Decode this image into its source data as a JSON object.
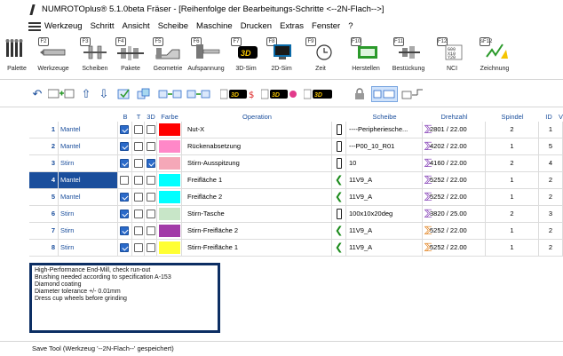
{
  "window": {
    "title": "NUMROTOplus®  5.1.0beta Fräser - [Reihenfolge der Bearbeitungs-Schritte <--2N-Flach-->]"
  },
  "menu": [
    "Werkzeug",
    "Schritt",
    "Ansicht",
    "Scheibe",
    "Maschine",
    "Drucken",
    "Extras",
    "Fenster",
    "?"
  ],
  "toolbar": [
    {
      "label": "Palette",
      "key": "",
      "icon": "palette-icon"
    },
    {
      "label": "Werkzeuge",
      "key": "F2",
      "icon": "tool-icon"
    },
    {
      "label": "Scheiben",
      "key": "F3",
      "icon": "wheel-icon"
    },
    {
      "label": "Pakete",
      "key": "F4",
      "icon": "package-icon"
    },
    {
      "label": "Geometrie",
      "key": "F5",
      "icon": "geometry-icon"
    },
    {
      "label": "Aufspannung",
      "key": "F6",
      "icon": "clamping-icon"
    },
    {
      "label": "3D-Sim",
      "key": "F7",
      "icon": "3d-sim-icon"
    },
    {
      "label": "2D-Sim",
      "key": "F8",
      "icon": "2d-sim-icon"
    },
    {
      "label": "Zeit",
      "key": "F9",
      "icon": "clock-icon"
    },
    {
      "label": "Herstellen",
      "key": "F10",
      "icon": "produce-icon"
    },
    {
      "label": "Bestückung",
      "key": "F11",
      "icon": "loading-icon"
    },
    {
      "label": "NCI",
      "key": "F12",
      "icon": "nci-icon"
    },
    {
      "label": "Zeichnung",
      "key": "sF12",
      "icon": "drawing-icon"
    }
  ],
  "grid": {
    "headers": {
      "b": "B",
      "t": "T",
      "d3": "3D",
      "farbe": "Farbe",
      "operation": "Operation",
      "scheibe": "Scheibe",
      "drehzahl": "Drehzahl",
      "spindel": "Spindel",
      "id": "ID",
      "more": "V"
    },
    "rows": [
      {
        "idx": "1",
        "name": "Mantel",
        "b": true,
        "t": false,
        "d3": false,
        "color": "#ff0000",
        "operation": "Nut-X",
        "tool": "bar",
        "scheibe": "----Peripheriesche...",
        "dz_icon": "violet",
        "drehzahl": "2801 / 22.00",
        "spindel": "2",
        "id": "1",
        "selected": false
      },
      {
        "idx": "2",
        "name": "Mantel",
        "b": true,
        "t": false,
        "d3": false,
        "color": "#ff88c8",
        "operation": "Rückenabsetzung",
        "tool": "bar",
        "scheibe": "---P00_10_R01",
        "dz_icon": "violet",
        "drehzahl": "4202 / 22.00",
        "spindel": "1",
        "id": "5",
        "selected": false
      },
      {
        "idx": "3",
        "name": "Stirn",
        "b": true,
        "t": false,
        "d3": true,
        "color": "#f5a8b8",
        "operation": "Stirn-Ausspitzung",
        "tool": "bar",
        "scheibe": "10",
        "dz_icon": "violet",
        "drehzahl": "4160 / 22.00",
        "spindel": "2",
        "id": "4",
        "selected": false
      },
      {
        "idx": "4",
        "name": "Mantel",
        "b": false,
        "t": false,
        "d3": false,
        "color": "#00ffff",
        "operation": "Freifläche 1",
        "tool": "arrow",
        "scheibe": "11V9_A",
        "dz_icon": "violet",
        "drehzahl": "5252 / 22.00",
        "spindel": "1",
        "id": "2",
        "selected": true
      },
      {
        "idx": "5",
        "name": "Mantel",
        "b": true,
        "t": false,
        "d3": false,
        "color": "#00ffff",
        "operation": "Freifläche 2",
        "tool": "arrow",
        "scheibe": "11V9_A",
        "dz_icon": "violet",
        "drehzahl": "5252 / 22.00",
        "spindel": "1",
        "id": "2",
        "selected": false
      },
      {
        "idx": "6",
        "name": "Stirn",
        "b": true,
        "t": false,
        "d3": false,
        "color": "#c8e6c8",
        "operation": "Stirn-Tasche",
        "tool": "bar",
        "scheibe": "100x10x20deg",
        "dz_icon": "violet",
        "drehzahl": "3820 / 25.00",
        "spindel": "2",
        "id": "3",
        "selected": false
      },
      {
        "idx": "7",
        "name": "Stirn",
        "b": true,
        "t": false,
        "d3": false,
        "color": "#a23aa8",
        "operation": "Stirn-Freifläche 2",
        "tool": "arrow",
        "scheibe": "11V9_A",
        "dz_icon": "orange",
        "drehzahl": "5252 / 22.00",
        "spindel": "1",
        "id": "2",
        "selected": false
      },
      {
        "idx": "8",
        "name": "Stirn",
        "b": true,
        "t": false,
        "d3": false,
        "color": "#ffff33",
        "operation": "Stirn-Freifläche 1",
        "tool": "arrow",
        "scheibe": "11V9_A",
        "dz_icon": "orange",
        "drehzahl": "5252 / 22.00",
        "spindel": "1",
        "id": "2",
        "selected": false
      }
    ]
  },
  "notes": [
    "High-Performance End-Mill, check run-out",
    "Brushing needed according to specification A-153",
    "Diamond coating",
    "Diameter tolerance +/- 0.01mm",
    "Dress cup wheels before grinding"
  ],
  "status": "Save Tool (Werkzeug '--2N-Flach--' gespeichert)",
  "colors": {
    "selection": "#1a4e9c",
    "notes_border": "#0c2e63",
    "link_text": "#1a4e9c"
  }
}
